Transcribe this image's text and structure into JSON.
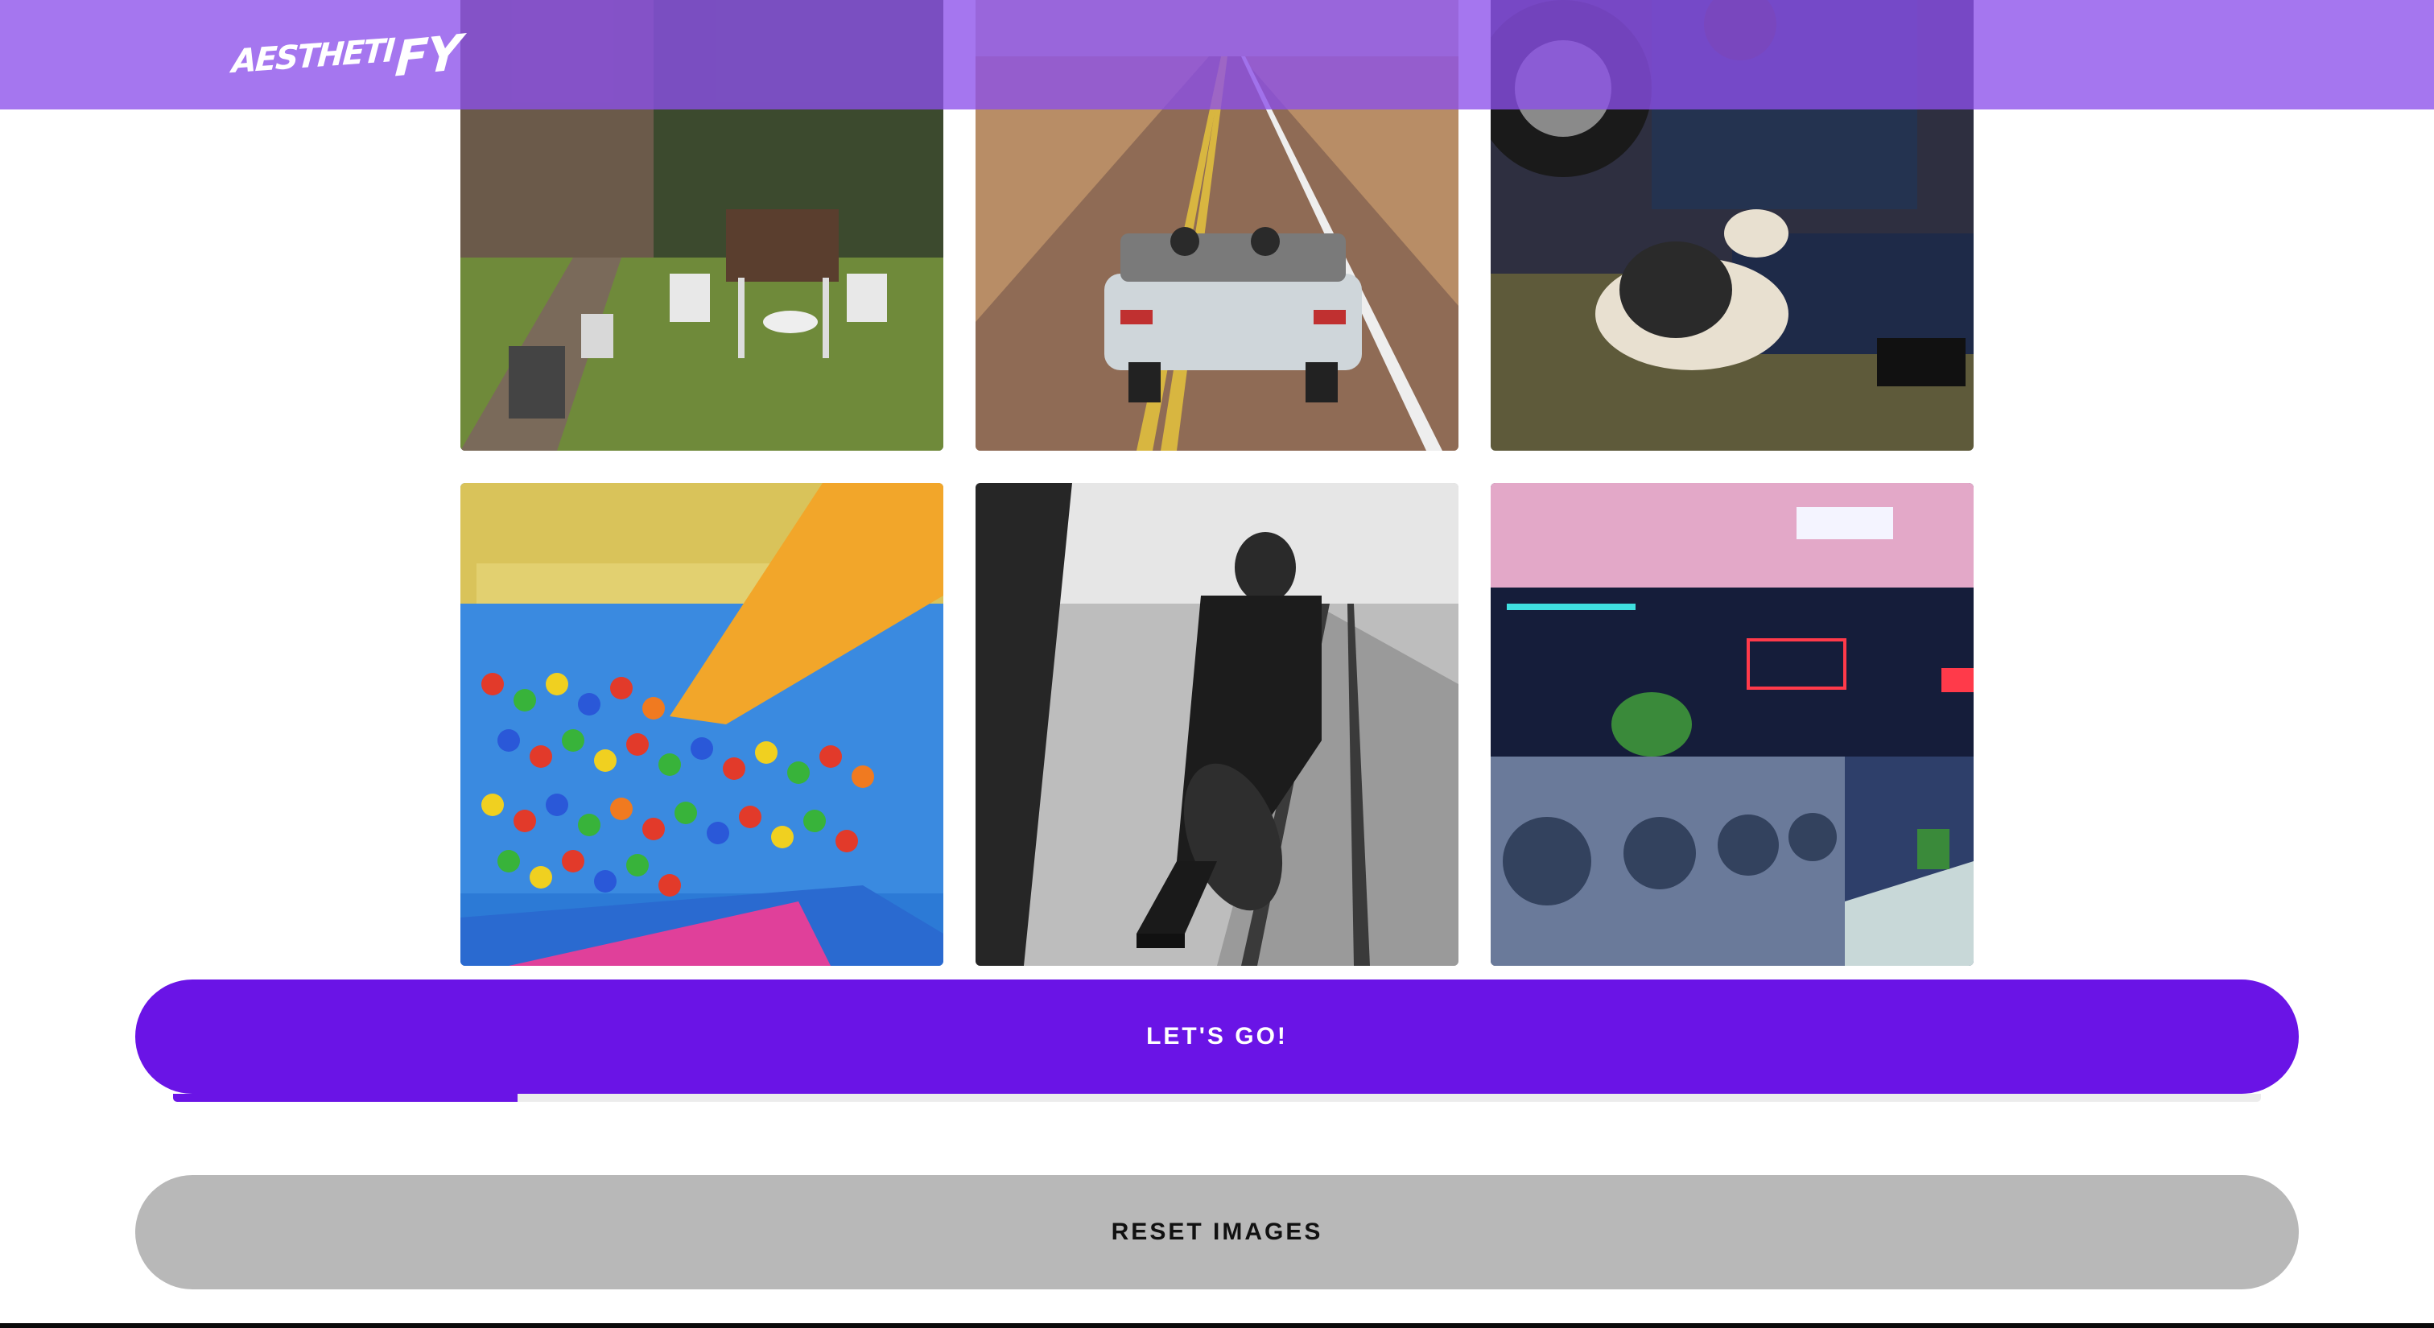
{
  "app": {
    "logo_text_small": "AESTHETI",
    "logo_text_big": "FY"
  },
  "images": [
    {
      "name": "garden-table-chairs",
      "icon": "photo"
    },
    {
      "name": "convertible-desert-road",
      "icon": "photo"
    },
    {
      "name": "man-with-dog",
      "icon": "photo"
    },
    {
      "name": "ball-pit-slide",
      "icon": "photo"
    },
    {
      "name": "man-with-cello-on-tracks",
      "icon": "photo"
    },
    {
      "name": "neon-laundromat",
      "icon": "photo"
    }
  ],
  "actions": {
    "go_label": "LET'S GO!",
    "reset_label": "RESET IMAGES"
  },
  "progress": {
    "fraction": 0.165
  },
  "colors": {
    "header": "#8c50eb",
    "accent": "#6a14e6",
    "reset": "#b8b8b8"
  }
}
